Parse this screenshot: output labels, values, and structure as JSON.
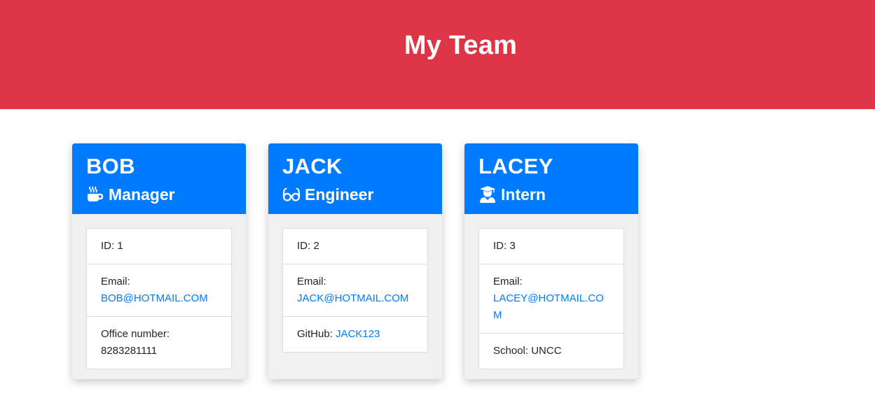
{
  "header": {
    "title": "My Team",
    "color": "#dc3545"
  },
  "cards": [
    {
      "name": "BOB",
      "role": "Manager",
      "role_icon": "mug-hot-icon",
      "id_label": "ID: 1",
      "email_label": "Email:",
      "email": "BOB@HOTMAIL.COM",
      "extra_label": "Office number:",
      "extra_value": "8283281111"
    },
    {
      "name": "JACK",
      "role": "Engineer",
      "role_icon": "glasses-icon",
      "id_label": "ID: 2",
      "email_label": "Email:",
      "email": "JACK@HOTMAIL.COM",
      "extra_label": "GitHub:",
      "extra_value": "JACK123"
    },
    {
      "name": "LACEY",
      "role": "Intern",
      "role_icon": "user-graduate-icon",
      "id_label": "ID: 3",
      "email_label": "Email:",
      "email": "LACEY@HOTMAIL.COM",
      "extra_label": "School:",
      "extra_value": "UNCC"
    }
  ],
  "colors": {
    "card_header": "#007bff",
    "card_body": "#f0f0f0",
    "link": "#007bff"
  }
}
